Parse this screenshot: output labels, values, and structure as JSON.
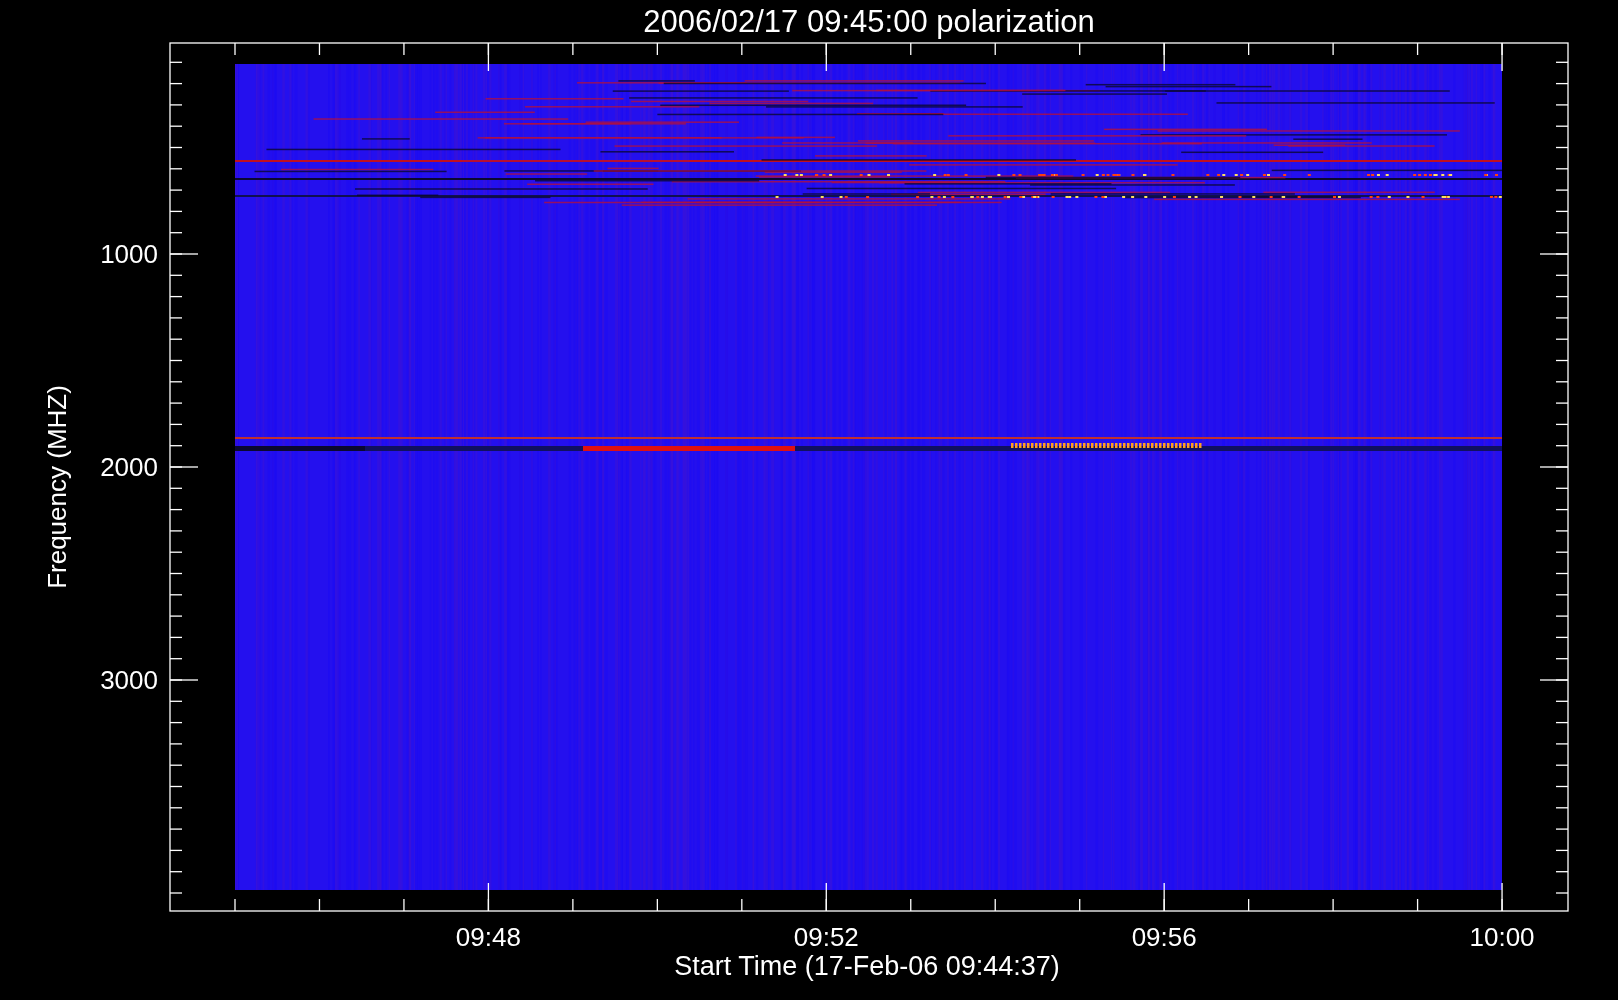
{
  "title": "2006/02/17 09:45:00 polarization",
  "y_axis": {
    "label": "Frequency (MHZ)",
    "ticks": [
      "1000",
      "2000",
      "3000"
    ]
  },
  "x_axis": {
    "label": "Start Time (17-Feb-06 09:44:37)",
    "ticks": [
      "09:48",
      "09:52",
      "09:56",
      "10:00"
    ]
  }
}
